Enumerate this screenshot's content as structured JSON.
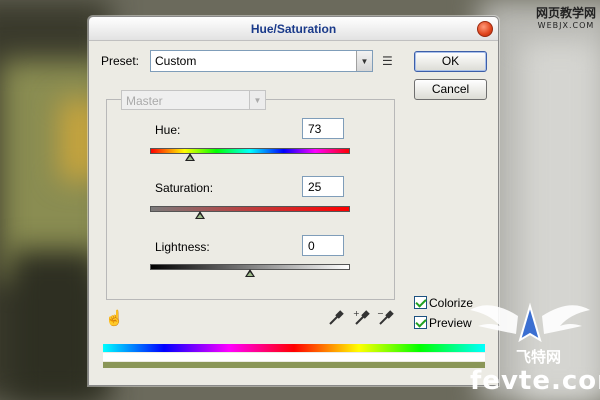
{
  "dialog": {
    "title": "Hue/Saturation"
  },
  "preset": {
    "label": "Preset:",
    "value": "Custom"
  },
  "buttons": {
    "ok": "OK",
    "cancel": "Cancel"
  },
  "channel": {
    "value": "Master"
  },
  "sliders": {
    "hue": {
      "label": "Hue:",
      "value": "73",
      "position_fraction": 0.2
    },
    "saturation": {
      "label": "Saturation:",
      "value": "25",
      "position_fraction": 0.25
    },
    "lightness": {
      "label": "Lightness:",
      "value": "0",
      "position_fraction": 0.5
    }
  },
  "options": {
    "colorize": {
      "label": "Colorize",
      "checked": true
    },
    "preview": {
      "label": "Preview",
      "checked": true
    }
  },
  "result_color": "#8a9657",
  "watermarks": {
    "top_cn": "网页教学网",
    "top_en": "WEBJX.COM",
    "bottom_cn": "飞特网",
    "bottom_en": "fevte.com"
  },
  "icons": {
    "close": "close-icon",
    "preset_options": "preset-options-icon",
    "hand": "hand-icon",
    "eyedropper": "eyedropper-icon",
    "eyedropper_plus": "eyedropper-plus-icon",
    "eyedropper_minus": "eyedropper-minus-icon"
  }
}
